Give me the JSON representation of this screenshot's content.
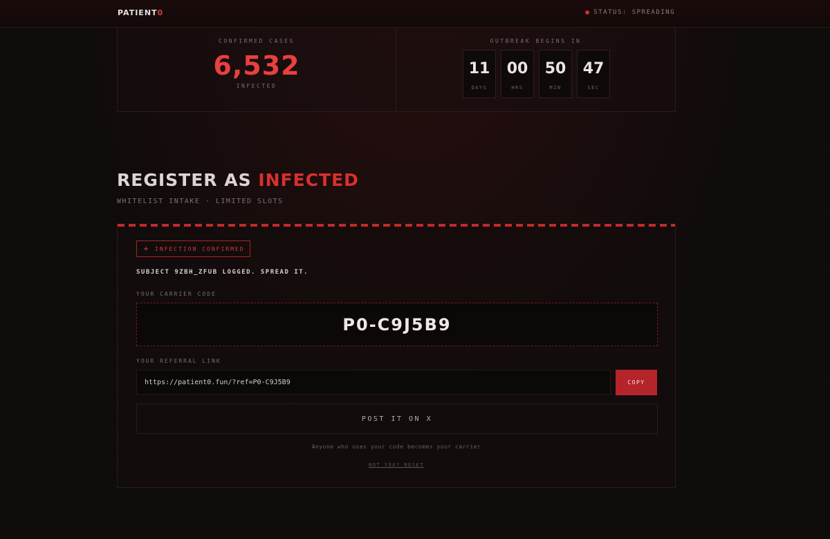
{
  "brand": {
    "name": "PATIENT",
    "accent": "0"
  },
  "status": {
    "text": "STATUS: SPREADING"
  },
  "stats": {
    "cases_label": "CONFIRMED CASES",
    "cases_value": "6,532",
    "cases_sub": "INFECTED",
    "countdown_label": "OUTBREAK BEGINS IN",
    "countdown": [
      {
        "value": "11",
        "unit": "DAYS"
      },
      {
        "value": "00",
        "unit": "HRS"
      },
      {
        "value": "50",
        "unit": "MIN"
      },
      {
        "value": "47",
        "unit": "SEC"
      }
    ]
  },
  "headline": {
    "prefix": "REGISTER AS ",
    "highlight": "INFECTED"
  },
  "subline": "WHITELIST INTAKE · LIMITED SLOTS",
  "panel": {
    "badge": "INFECTION CONFIRMED",
    "badge_icon": "+",
    "subject": "SUBJECT 9ZBH_ZFUB LOGGED. SPREAD IT.",
    "carrier_label": "YOUR CARRIER CODE",
    "carrier_code": "P0-C9J5B9",
    "referral_label": "YOUR REFERRAL LINK",
    "referral_link": "https://patient0.fun/?ref=P0-C9J5B9",
    "copy_label": "COPY",
    "post_label": "POST IT ON X",
    "note": "Anyone who uses your code becomes your carrier",
    "reset_label": "NOT YOU? RESET"
  },
  "colors": {
    "accent": "#d8302f",
    "background": "#0d0a0a"
  }
}
